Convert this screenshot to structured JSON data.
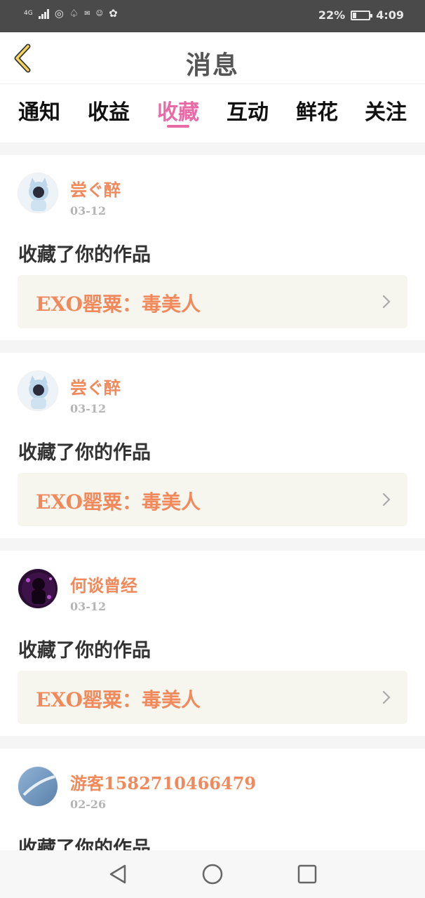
{
  "status_bar": {
    "network": "4G",
    "battery_text": "22%",
    "battery_level": 0.22,
    "time": "4:09"
  },
  "header": {
    "title": "消息"
  },
  "tabs": [
    {
      "label": "通知",
      "active": false
    },
    {
      "label": "收益",
      "active": false
    },
    {
      "label": "收藏",
      "active": true
    },
    {
      "label": "互动",
      "active": false
    },
    {
      "label": "鲜花",
      "active": false
    },
    {
      "label": "关注",
      "active": false
    }
  ],
  "messages": [
    {
      "user": "尝ぐ醉",
      "date": "03-12",
      "action": "收藏了你的作品",
      "work": "EXO罂粟：毒美人"
    },
    {
      "user": "尝ぐ醉",
      "date": "03-12",
      "action": "收藏了你的作品",
      "work": "EXO罂粟：毒美人"
    },
    {
      "user": "何谈曾经",
      "date": "03-12",
      "action": "收藏了你的作品",
      "work": "EXO罂粟：毒美人"
    },
    {
      "user": "游客1582710466479",
      "date": "02-26",
      "action": "收藏了你的作品"
    }
  ],
  "colors": {
    "accent": "#e86aa6",
    "username": "#f08a5d",
    "card_bg": "#f6f5ee"
  }
}
